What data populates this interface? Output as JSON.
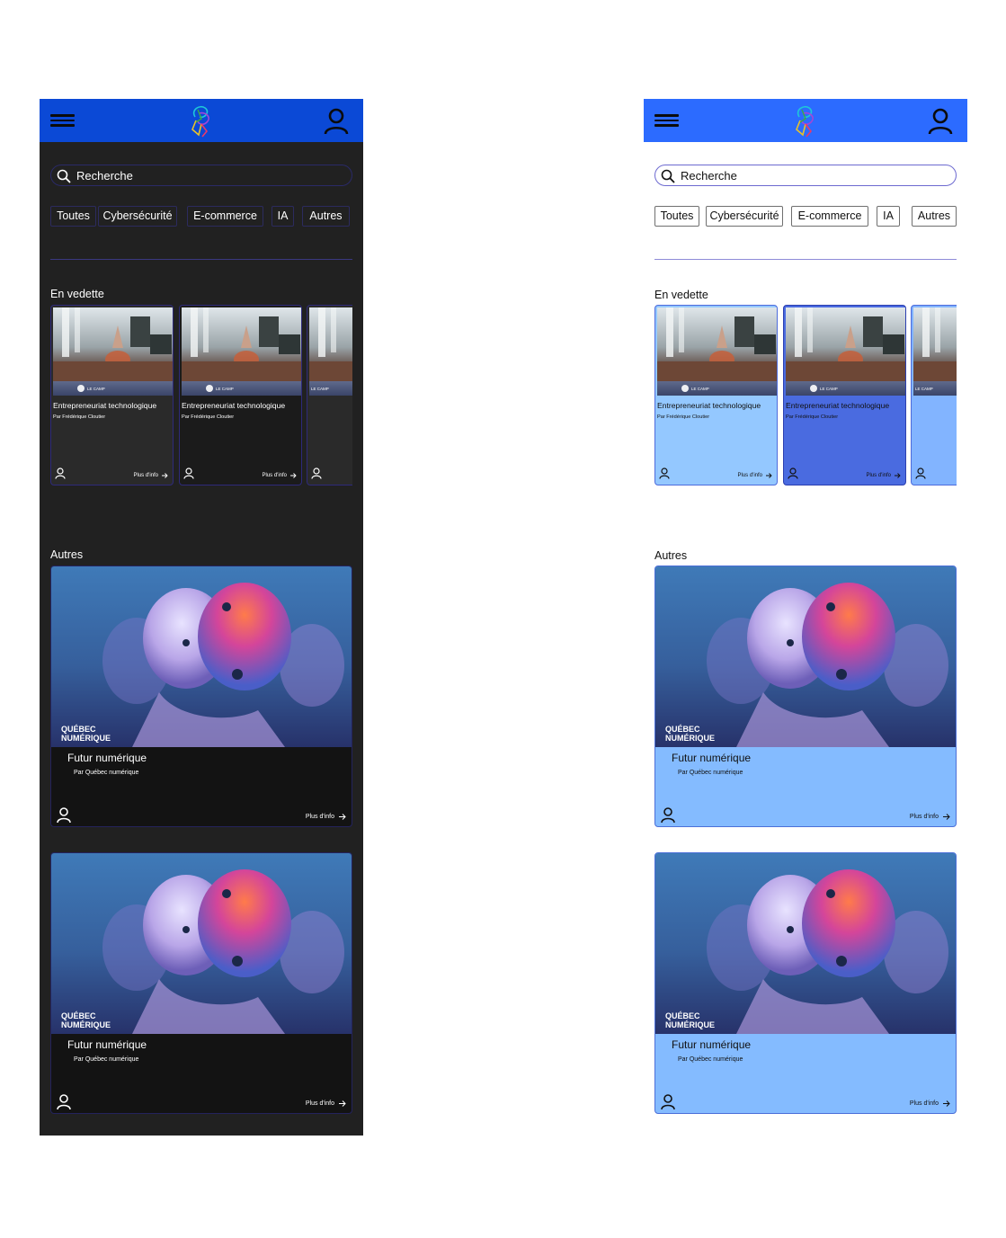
{
  "search": {
    "placeholder": "Recherche"
  },
  "filters": [
    "Toutes",
    "Cybersécurité",
    "E-commerce",
    "IA",
    "Autres"
  ],
  "featured": {
    "title": "En vedette",
    "cards": [
      {
        "title": "Entrepreneuriat technologique",
        "author": "Par Frédérique Cloutier",
        "more": "Plus d'info",
        "brand": "LE CAMP"
      },
      {
        "title": "Entrepreneuriat technologique",
        "author": "Par Frédérique Cloutier",
        "more": "Plus d'info",
        "brand": "LE CAMP"
      },
      {
        "title": "",
        "author": "",
        "more": "",
        "brand": "LE CAMP"
      }
    ]
  },
  "others": {
    "title": "Autres",
    "cards": [
      {
        "title": "Futur numérique",
        "author": "Par Québec numérique",
        "more": "Plus d'info",
        "brand_line1": "QUÉBEC",
        "brand_line2": "NUMÉRIQUE"
      },
      {
        "title": "Futur numérique",
        "author": "Par Québec numérique",
        "more": "Plus d'info",
        "brand_line1": "QUÉBEC",
        "brand_line2": "NUMÉRIQUE"
      }
    ]
  },
  "colors": {
    "dark_header": "#0b49d6",
    "light_header": "#2c6bff",
    "dark_background": "#212121",
    "light_card": "#94c8ff",
    "light_card_selected": "#4a6be0"
  },
  "icons": [
    "hamburger-menu-icon",
    "app-logo",
    "profile-icon",
    "search-icon",
    "person-icon",
    "arrow-right-icon"
  ]
}
